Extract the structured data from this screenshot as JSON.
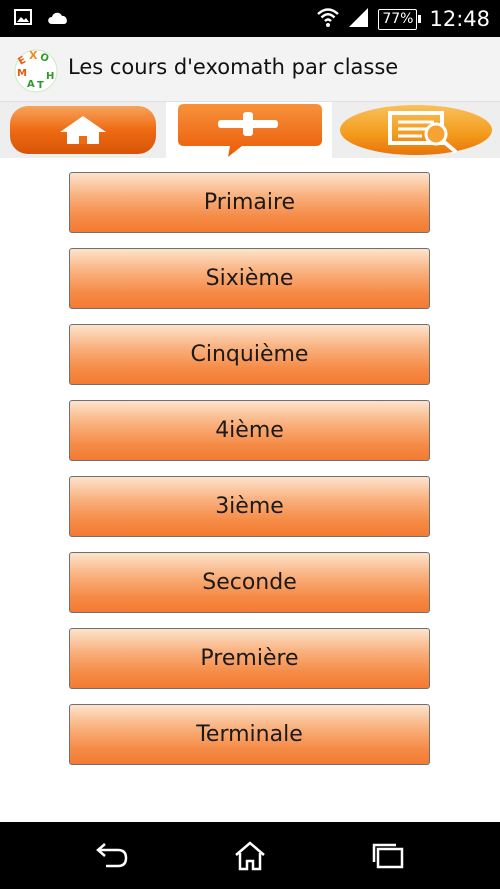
{
  "status_bar": {
    "icons": [
      "gallery-icon",
      "cloud-icon",
      "wifi-icon",
      "signal-icon"
    ],
    "battery_label": "77%",
    "time": "12:48"
  },
  "action_bar": {
    "title": "Les cours d'exomath par classe",
    "logo_letters": "EXOMATH"
  },
  "toolbar": {
    "items": [
      {
        "icon": "home-icon",
        "color": "#ee6b12"
      },
      {
        "icon": "add-comment-icon",
        "color": "#f0660c"
      },
      {
        "icon": "search-document-icon",
        "color": "#f0850f"
      }
    ]
  },
  "classes": [
    {
      "label": "Primaire"
    },
    {
      "label": "Sixième"
    },
    {
      "label": "Cinquième"
    },
    {
      "label": "4ième"
    },
    {
      "label": "3ième"
    },
    {
      "label": "Seconde"
    },
    {
      "label": "Première"
    },
    {
      "label": "Terminale"
    }
  ],
  "nav_bar": {
    "icons": [
      "back-icon",
      "home-icon",
      "recents-icon"
    ]
  }
}
